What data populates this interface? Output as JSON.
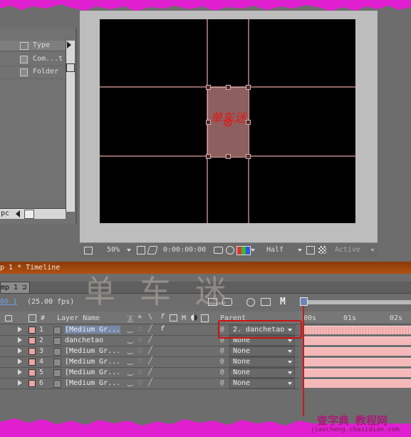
{
  "project": {
    "column_type": "Type",
    "rows": [
      {
        "type": "Com...t"
      },
      {
        "type": "Folder"
      }
    ],
    "bottom_label": "pc"
  },
  "viewer": {
    "zoom": "50%",
    "timecode": "0:00:00:00",
    "resolution": "Half",
    "camera": "Active",
    "layer_text": "单车迷"
  },
  "timeline": {
    "title": "p 1 * Timeline",
    "tab": "mp 1",
    "current_time": "00 1",
    "fps": "(25.00 fps)",
    "mode_button": "M",
    "headers": {
      "number": "#",
      "layer_name": "Layer Name",
      "parent": "Parent",
      "m": "M"
    },
    "ruler_ticks": [
      "00s",
      "01s",
      "02s"
    ],
    "layers": [
      {
        "num": "1",
        "name": "[Medium Gr...",
        "parent": "2. danchetao"
      },
      {
        "num": "2",
        "name": "danchetao",
        "parent": "None"
      },
      {
        "num": "3",
        "name": "[Medium Gr...",
        "parent": "None"
      },
      {
        "num": "4",
        "name": "[Medium Gr...",
        "parent": "None"
      },
      {
        "num": "5",
        "name": "[Medium Gr...",
        "parent": "None"
      },
      {
        "num": "6",
        "name": "[Medium Gr...",
        "parent": "None"
      }
    ]
  },
  "watermark": {
    "big_text": "单车迷",
    "site_logo": "查字典 教程网",
    "site_url": "jiaocheng.chazidian.com"
  },
  "colors": {
    "torn_pink": "#e020d0",
    "layer_label": "#f0a3a3",
    "timeline_title": "#a0460e",
    "highlight": "#d01010"
  }
}
